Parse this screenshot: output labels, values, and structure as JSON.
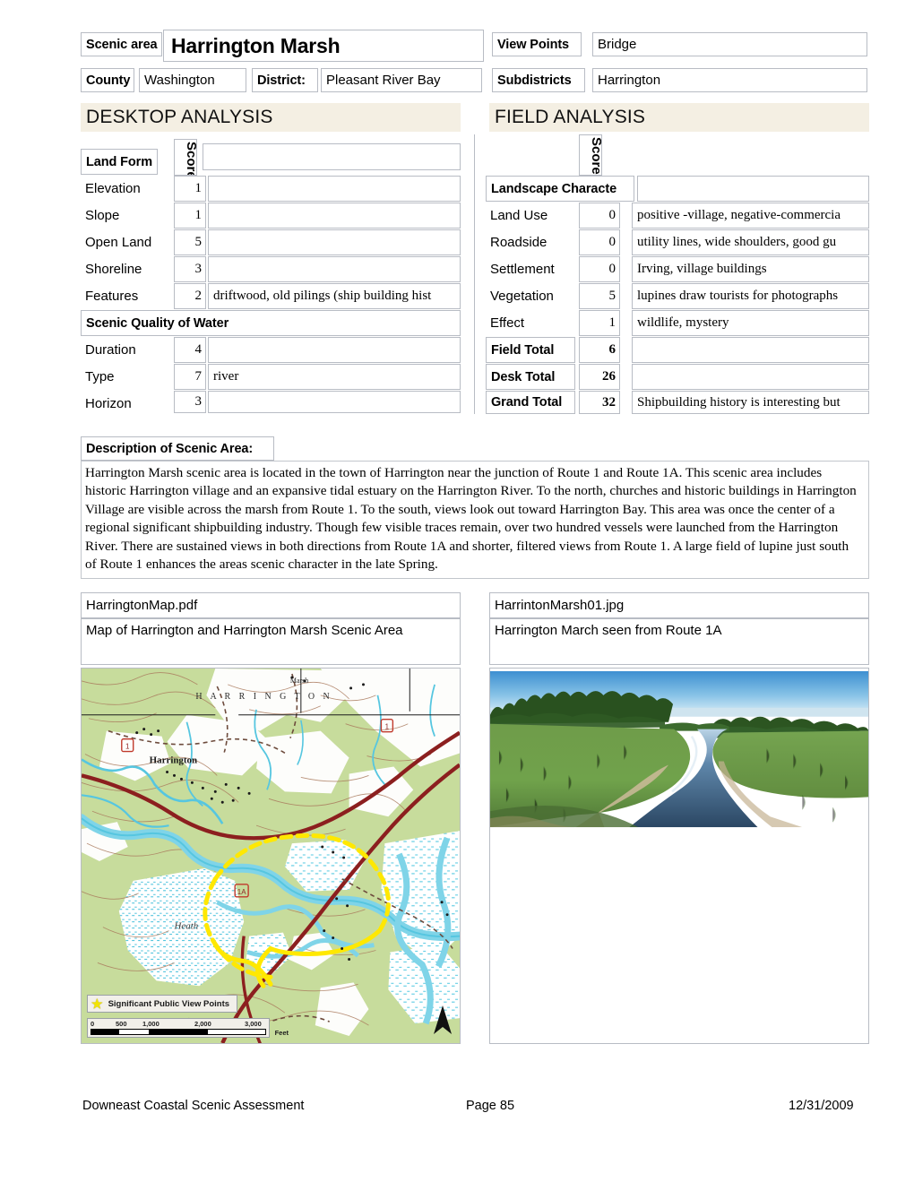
{
  "header": {
    "scenic_area_label": "Scenic area",
    "scenic_area_value": "Harrington Marsh",
    "view_points_label": "View Points",
    "view_points_value": "Bridge",
    "county_label": "County",
    "county_value": "Washington",
    "district_label": "District:",
    "district_value": "Pleasant River Bay",
    "subdistricts_label": "Subdistricts",
    "subdistricts_value": "Harrington"
  },
  "desktop_analysis": {
    "banner": "DESKTOP ANALYSIS",
    "score_header": "Score",
    "groups": [
      {
        "group_label": "Land Form",
        "rows": [
          {
            "label": "Elevation",
            "score": "1",
            "note": ""
          },
          {
            "label": "Slope",
            "score": "1",
            "note": ""
          },
          {
            "label": "Open Land",
            "score": "5",
            "note": ""
          },
          {
            "label": "Shoreline",
            "score": "3",
            "note": ""
          },
          {
            "label": "Features",
            "score": "2",
            "note": "driftwood, old  pilings (ship building hist"
          }
        ]
      },
      {
        "group_label": "Scenic Quality of Water",
        "rows": [
          {
            "label": "Duration",
            "score": "4",
            "note": ""
          },
          {
            "label": "Type",
            "score": "7",
            "note": "river"
          },
          {
            "label": "Horizon",
            "score": "3",
            "note": ""
          }
        ]
      }
    ]
  },
  "field_analysis": {
    "banner": "FIELD ANALYSIS",
    "score_header": "Score",
    "group_label": "Landscape Characte",
    "rows": [
      {
        "label": "Land Use",
        "score": "0",
        "note": "positive -village, negative-commercia"
      },
      {
        "label": "Roadside",
        "score": "0",
        "note": "utility lines, wide shoulders, good gu"
      },
      {
        "label": "Settlement",
        "score": "0",
        "note": "Irving, village buildings"
      },
      {
        "label": "Vegetation",
        "score": "5",
        "note": "lupines draw tourists for photographs"
      },
      {
        "label": "Effect",
        "score": "1",
        "note": "wildlife, mystery"
      }
    ],
    "totals": [
      {
        "label": "Field Total",
        "score": "6",
        "note": ""
      },
      {
        "label": "Desk Total",
        "score": "26",
        "note": ""
      },
      {
        "label": "Grand Total",
        "score": "32",
        "note": "Shipbuilding history is interesting but"
      }
    ]
  },
  "description": {
    "label": "Description of Scenic Area:",
    "body": "Harrington Marsh scenic area is located in the town of Harrington near the junction of Route 1 and Route 1A. This scenic area includes historic Harrington village and an expansive tidal estuary on the Harrington River. To the north, churches and historic buildings in Harrington Village are visible across the marsh from Route 1. To the south, views look out toward Harrington Bay. This area was once the center of a regional significant shipbuilding industry. Though few visible traces remain, over two hundred vessels were launched from the Harrington River. There are sustained views in both directions from Route 1A and shorter, filtered views from Route 1. A large field of lupine just south of Route 1 enhances the areas scenic character in the late Spring."
  },
  "media": {
    "left": {
      "filename": "HarringtonMap.pdf",
      "caption": "Map of Harrington and Harrington Marsh Scenic Area",
      "map_labels": {
        "town_caps": "H A R R I N G T O N",
        "village": "Harrington",
        "heath": "Heath",
        "marsh_note": "Marsh",
        "legend": "Significant Public View Points",
        "scale_0": "0",
        "scale_500": "500",
        "scale_1000": "1,000",
        "scale_2000": "2,000",
        "scale_3000": "3,000",
        "scale_unit": "Feet",
        "route_1_a": "1",
        "route_1_b": "1",
        "route_1_c": "1A"
      }
    },
    "right": {
      "filename": "HarrintonMarsh01.jpg",
      "caption": "Harrington March seen from Route 1A"
    }
  },
  "footer": {
    "left": "Downeast Coastal Scenic Assessment",
    "center": "Page 85",
    "right": "12/31/2009"
  },
  "colors": {
    "banner_bg": "#f4efe3",
    "border": "#b8bcc4",
    "map_land": "#c7dc9c",
    "map_water": "#7fd4e8",
    "map_road": "#8c1f1f",
    "map_highlight": "#ffe800"
  }
}
